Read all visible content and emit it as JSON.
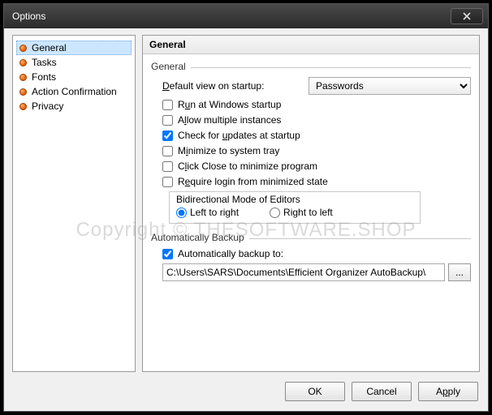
{
  "window": {
    "title": "Options"
  },
  "nav": {
    "items": [
      {
        "label": "General"
      },
      {
        "label": "Tasks"
      },
      {
        "label": "Fonts"
      },
      {
        "label": "Action Confirmation"
      },
      {
        "label": "Privacy"
      }
    ],
    "selected_index": 0
  },
  "main": {
    "header": "General",
    "group_general": {
      "title": "General",
      "default_view_label_pre": "D",
      "default_view_label_post": "efault view on startup:",
      "default_view_value": "Passwords",
      "checks": {
        "run_startup": {
          "pre": "R",
          "mid": "u",
          "post": "n at Windows startup",
          "checked": false
        },
        "allow_multi": {
          "pre": "A",
          "mid": "l",
          "post": "low multiple instances",
          "checked": false
        },
        "check_updates": {
          "pre": "Check for ",
          "mid": "u",
          "post": "pdates at startup",
          "checked": true
        },
        "minimize_tray": {
          "pre": "M",
          "mid": "i",
          "post": "nimize to system tray",
          "checked": false
        },
        "click_close": {
          "pre": "C",
          "mid": "l",
          "post": "ick Close to minimize program",
          "checked": false
        },
        "require_login": {
          "pre": "R",
          "mid": "e",
          "post": "quire login from minimized state",
          "checked": false
        }
      },
      "bidirectional": {
        "title": "Bidirectional Mode of Editors",
        "ltr": "Left to right",
        "rtl": "Right to left",
        "value": "ltr"
      }
    },
    "group_backup": {
      "title": "Automatically Backup",
      "auto_backup": {
        "label": "Automatically backup to:",
        "checked": true
      },
      "path": "C:\\Users\\SARS\\Documents\\Efficient Organizer AutoBackup\\",
      "browse_label": "..."
    }
  },
  "footer": {
    "ok": "OK",
    "cancel": "Cancel",
    "apply_pre": "A",
    "apply_mid": "p",
    "apply_post": "ply"
  },
  "watermark": "Copyright © THESOFTWARE.SHOP"
}
